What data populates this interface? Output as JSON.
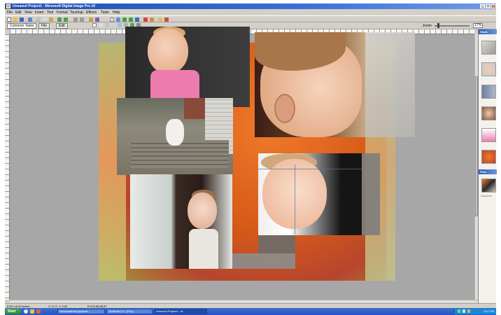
{
  "window": {
    "title": "Unsaved Project1 - Microsoft Digital Image Pro 10",
    "minimize": "_",
    "maximize": "□",
    "close": "x"
  },
  "menu": [
    "File",
    "Edit",
    "View",
    "Insert",
    "Tool",
    "Format",
    "Touchup",
    "Effects",
    "Tools",
    "Help"
  ],
  "tabs": {
    "common_tasks": "Common Tasks",
    "file": "File",
    "edit": "Edit"
  },
  "zoom": {
    "label": "Zoom",
    "value": "17%"
  },
  "panels": {
    "stack": "Stack",
    "files": "Files",
    "file_caption": "Unsaved Pr..."
  },
  "status": {
    "size": "8.00 x 8.00 inches",
    "position": "X: 3.77, Y: 4.92",
    "pixel": "R:G:B 88,88,87"
  },
  "taskbar": {
    "start": "Start",
    "items": [
      "Nonsinkwheel Applicat...",
      "OneNote 2.0 - [Proj...",
      "Unsaved Project1 - M..."
    ],
    "clock": "3:47 PM"
  },
  "colors": {
    "title_bar": "#1e4fb0",
    "workspace": "#a7a7a7",
    "page_orange": "#f07a2a",
    "taskbar": "#2855b8"
  }
}
